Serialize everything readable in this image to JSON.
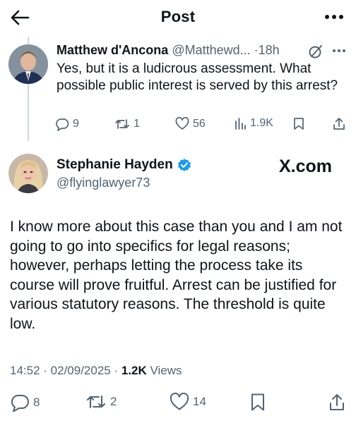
{
  "header": {
    "title": "Post",
    "back_icon": "arrow-left-icon",
    "more_icon": "more-horizontal-icon"
  },
  "reply": {
    "author_name": "Matthew d'Ancona",
    "handle": "@Matthewd...",
    "separator": "·",
    "time": "18h",
    "text": "Yes, but it is a ludicrous assessment. What possible public interest is served by this arrest?",
    "actions": {
      "replies": "9",
      "reposts": "1",
      "likes": "56",
      "views": "1.9K"
    }
  },
  "post": {
    "author_name": "Stephanie Hayden",
    "handle": "@flyinglawyer73",
    "watermark": "X.com",
    "verified_color": "#1d9bf0",
    "text": "I know more about this case than you and I am not going to go into specifics for legal reasons; however, perhaps letting the process take its course will prove fruitful. Arrest can be justified for various statutory reasons. The threshold is quite low.",
    "time": "14:52",
    "date": "02/09/2025",
    "views_count": "1.2K",
    "views_label": "Views",
    "actions": {
      "replies": "8",
      "reposts": "2",
      "likes": "14"
    }
  }
}
